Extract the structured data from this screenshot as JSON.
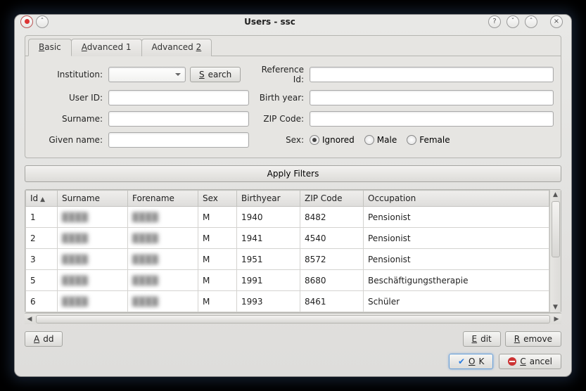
{
  "window": {
    "title": "Users - ssc"
  },
  "tabs": {
    "basic": "Basic",
    "adv1": "Advanced 1",
    "adv2": "Advanced 2",
    "basic_accel": "B",
    "adv1_accel": "A",
    "adv2_accel": "2"
  },
  "form": {
    "institution_label": "Institution:",
    "search_label": "Search",
    "user_id_label": "User ID:",
    "surname_label": "Surname:",
    "given_name_label": "Given name:",
    "reference_id_label": "Reference Id:",
    "birth_year_label": "Birth year:",
    "zip_label": "ZIP Code:",
    "sex_label": "Sex:",
    "sex_options": {
      "ignored": "Ignored",
      "male": "Male",
      "female": "Female"
    },
    "values": {
      "institution": "",
      "user_id": "",
      "surname": "",
      "given_name": "",
      "reference_id": "",
      "birth_year": "",
      "zip": ""
    }
  },
  "apply_label": "Apply Filters",
  "table": {
    "columns": {
      "id": "Id",
      "surname": "Surname",
      "forename": "Forename",
      "sex": "Sex",
      "birthyear": "Birthyear",
      "zip": "ZIP Code",
      "occupation": "Occupation"
    },
    "rows": [
      {
        "id": "1",
        "surname": "████",
        "forename": "████",
        "sex": "M",
        "birthyear": "1940",
        "zip": "8482",
        "occupation": "Pensionist"
      },
      {
        "id": "2",
        "surname": "████",
        "forename": "████",
        "sex": "M",
        "birthyear": "1941",
        "zip": "4540",
        "occupation": "Pensionist"
      },
      {
        "id": "3",
        "surname": "████",
        "forename": "████",
        "sex": "M",
        "birthyear": "1951",
        "zip": "8572",
        "occupation": "Pensionist"
      },
      {
        "id": "5",
        "surname": "████",
        "forename": "████",
        "sex": "M",
        "birthyear": "1991",
        "zip": "8680",
        "occupation": "Beschäftigungstherapie"
      },
      {
        "id": "6",
        "surname": "████",
        "forename": "████",
        "sex": "M",
        "birthyear": "1993",
        "zip": "8461",
        "occupation": "Schüler"
      }
    ]
  },
  "buttons": {
    "add": "Add",
    "edit": "Edit",
    "remove": "Remove",
    "ok": "OK",
    "cancel": "Cancel"
  }
}
